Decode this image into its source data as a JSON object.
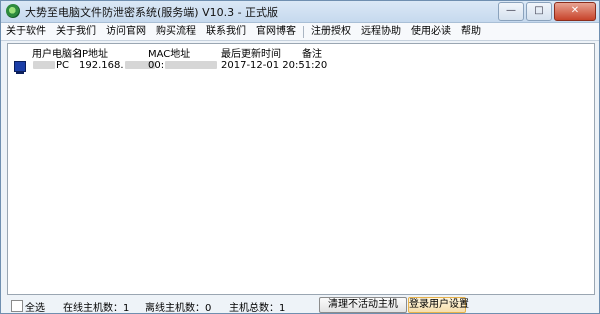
{
  "window": {
    "title": "大势至电脑文件防泄密系统(服务端) V10.3 - 正式版"
  },
  "menu": [
    "关于软件",
    "关于我们",
    "访问官网",
    "购买流程",
    "联系我们",
    "官网博客",
    "注册授权",
    "远程协助",
    "使用必读",
    "帮助"
  ],
  "table": {
    "headers": [
      "用户电脑名",
      "IP地址",
      "MAC地址",
      "最后更新时间",
      "备注"
    ],
    "rows": [
      {
        "name_suffix": "PC",
        "ip_prefix": "192.168.",
        "mac_prefix": "00:",
        "updated": "2017-12-01 20:51:20",
        "note": ""
      }
    ]
  },
  "status": {
    "select_all": "全选",
    "online": "在线主机数：1",
    "offline": "离线主机数：0",
    "total": "主机总数：1",
    "clean_button": "清理不活动主机",
    "login_button": "登录用户设置"
  }
}
